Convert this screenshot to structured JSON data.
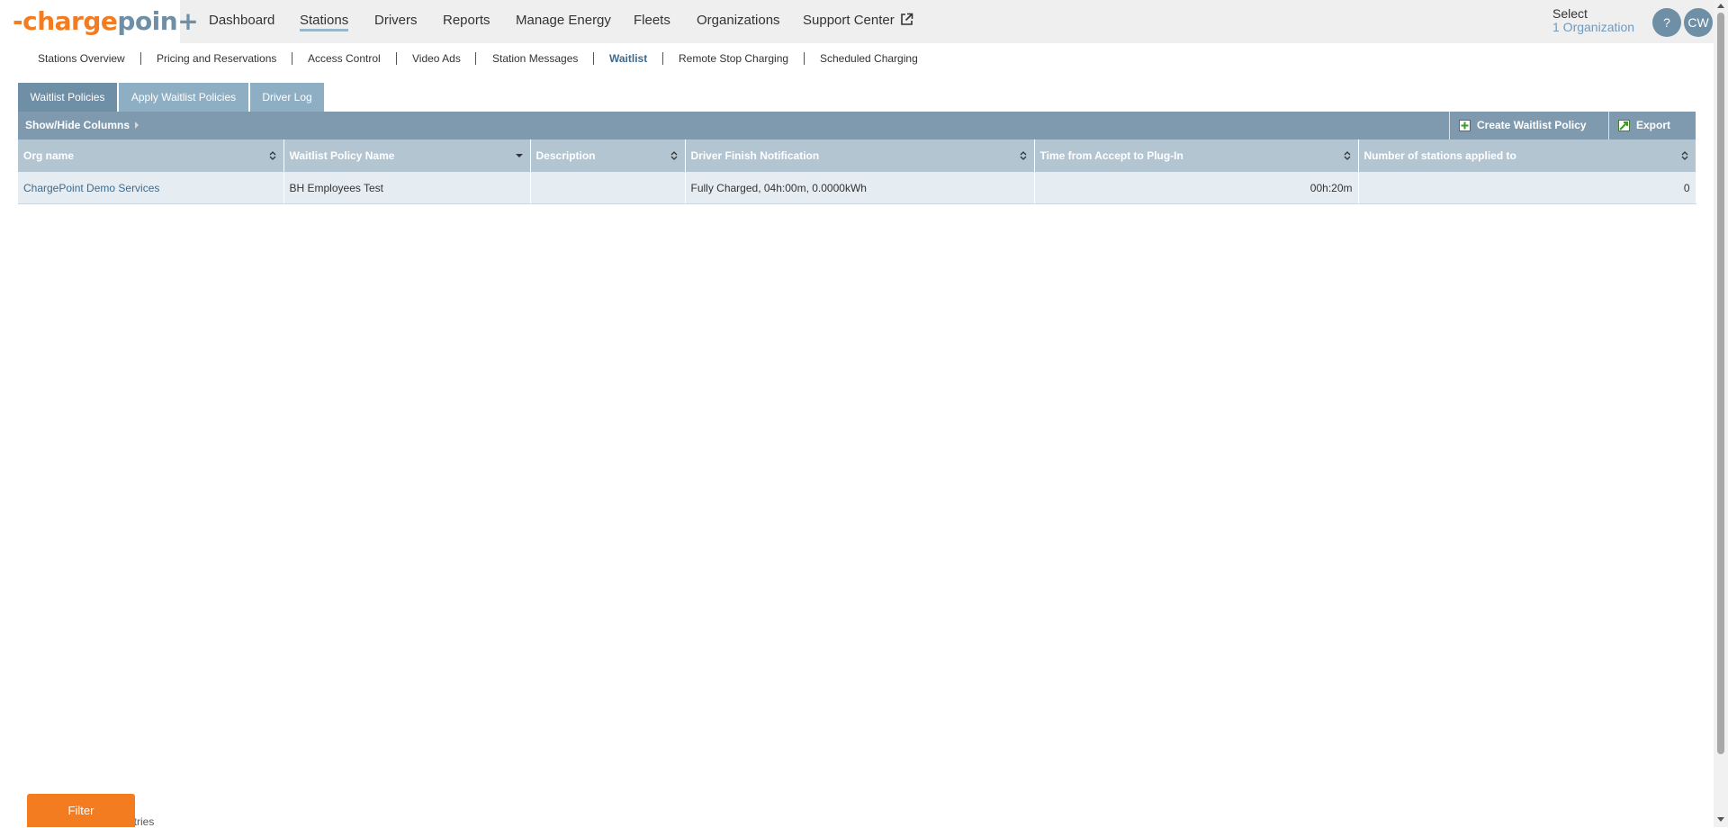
{
  "brand": {
    "logo_prefix": "-",
    "logo_charge": "charge",
    "logo_point": "poin",
    "logo_suffix": "+",
    "colors": {
      "orange": "#f47c20",
      "slate": "#6e8fa5",
      "header": "#7f9aaf"
    }
  },
  "topnav": {
    "items": [
      {
        "label": "Dashboard"
      },
      {
        "label": "Stations",
        "active": true
      },
      {
        "label": "Drivers"
      },
      {
        "label": "Reports"
      },
      {
        "label": "Manage Energy"
      },
      {
        "label": "Fleets"
      },
      {
        "label": "Organizations"
      },
      {
        "label": "Support Center",
        "icon": "external-link-icon"
      }
    ],
    "select_label": "Select",
    "org_label": "1 Organization",
    "help_label": "?",
    "user_initials": "CW"
  },
  "subnav": {
    "items": [
      {
        "label": "Stations Overview"
      },
      {
        "label": "Pricing and Reservations"
      },
      {
        "label": "Access Control"
      },
      {
        "label": "Video Ads"
      },
      {
        "label": "Station Messages"
      },
      {
        "label": "Waitlist",
        "active": true
      },
      {
        "label": "Remote Stop Charging"
      },
      {
        "label": "Scheduled Charging"
      }
    ]
  },
  "tabs": [
    {
      "label": "Waitlist Policies",
      "active": true
    },
    {
      "label": "Apply Waitlist Policies"
    },
    {
      "label": "Driver Log"
    }
  ],
  "toolbar": {
    "show_hide_label": "Show/Hide Columns",
    "create_label": "Create Waitlist Policy",
    "export_label": "Export"
  },
  "table": {
    "columns": [
      "Org name",
      "Waitlist Policy Name",
      "Description",
      "Driver Finish Notification",
      "Time from Accept to Plug-In",
      "Number of stations applied to"
    ],
    "rows": [
      {
        "org_name": "ChargePoint Demo Services",
        "policy_name": "BH Employees Test",
        "description": "",
        "finish_notification": "Fully Charged, 04h:00m, 0.0000kWh",
        "accept_to_plugin": "00h:20m",
        "stations_applied": "0"
      }
    ]
  },
  "footer": {
    "filter_label": "Filter",
    "entries_text": "ntries"
  }
}
